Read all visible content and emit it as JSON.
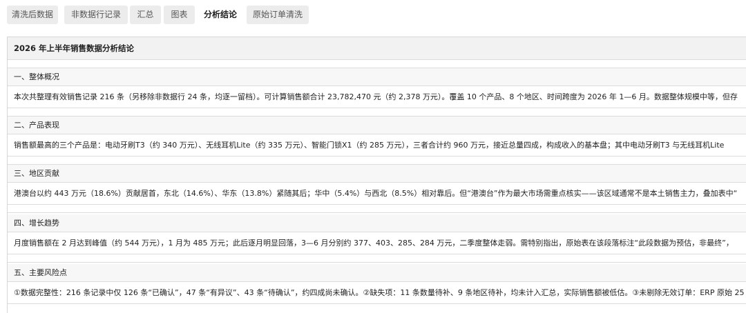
{
  "tabs": [
    {
      "label": "清洗后数据",
      "active": false
    },
    {
      "label": "非数据行记录",
      "active": false
    },
    {
      "label": "汇总",
      "active": false
    },
    {
      "label": "图表",
      "active": false
    },
    {
      "label": "分析结论",
      "active": true
    },
    {
      "label": "原始订单清洗",
      "active": false
    }
  ],
  "sheet": {
    "title": "2026 年上半年销售数据分析结论",
    "sections": [
      {
        "heading": "一、整体概况",
        "body": "本次共整理有效销售记录 216 条（另移除非数据行 24 条，均逐一留档）。可计算销售额合计 23,782,470 元（约 2,378 万元）。覆盖 10 个产品、8 个地区、时间跨度为 2026 年 1—6 月。数据整体规模中等，但存"
      },
      {
        "heading": "二、产品表现",
        "body": "销售额最高的三个产品是：电动牙刷T3（约 340 万元）、无线耳机Lite（约 335 万元）、智能门锁X1（约 285 万元），三者合计约 960 万元，接近总量四成，构成收入的基本盘；其中电动牙刷T3 与无线耳机Lite"
      },
      {
        "heading": "三、地区贡献",
        "body": "港澳台以约 443 万元（18.6%）贡献居首，东北（14.6%）、华东（13.8%）紧随其后；华中（5.4%）与西北（8.5%）相对靠后。但“港澳台”作为最大市场需重点核实——该区域通常不是本土销售主力，叠加表中“"
      },
      {
        "heading": "四、增长趋势",
        "body": "月度销售额在 2 月达到峰值（约 544 万元），1 月为 485 万元；此后逐月明显回落，3—6 月分别约 377、403、285、284 万元，二季度整体走弱。需特别指出，原始表在该段落标注“此段数据为预估，非最终”，"
      },
      {
        "heading": "五、主要风险点",
        "body": "①数据完整性：216 条记录中仅 126 条“已确认”，47 条“有异议”、43 条“待确认”，约四成尚未确认。②缺失项：11 条数量待补、9 条地区待补，均未计入汇总，实际销售额被低估。③未剔除无效订单：ERP 原始 25"
      }
    ]
  }
}
